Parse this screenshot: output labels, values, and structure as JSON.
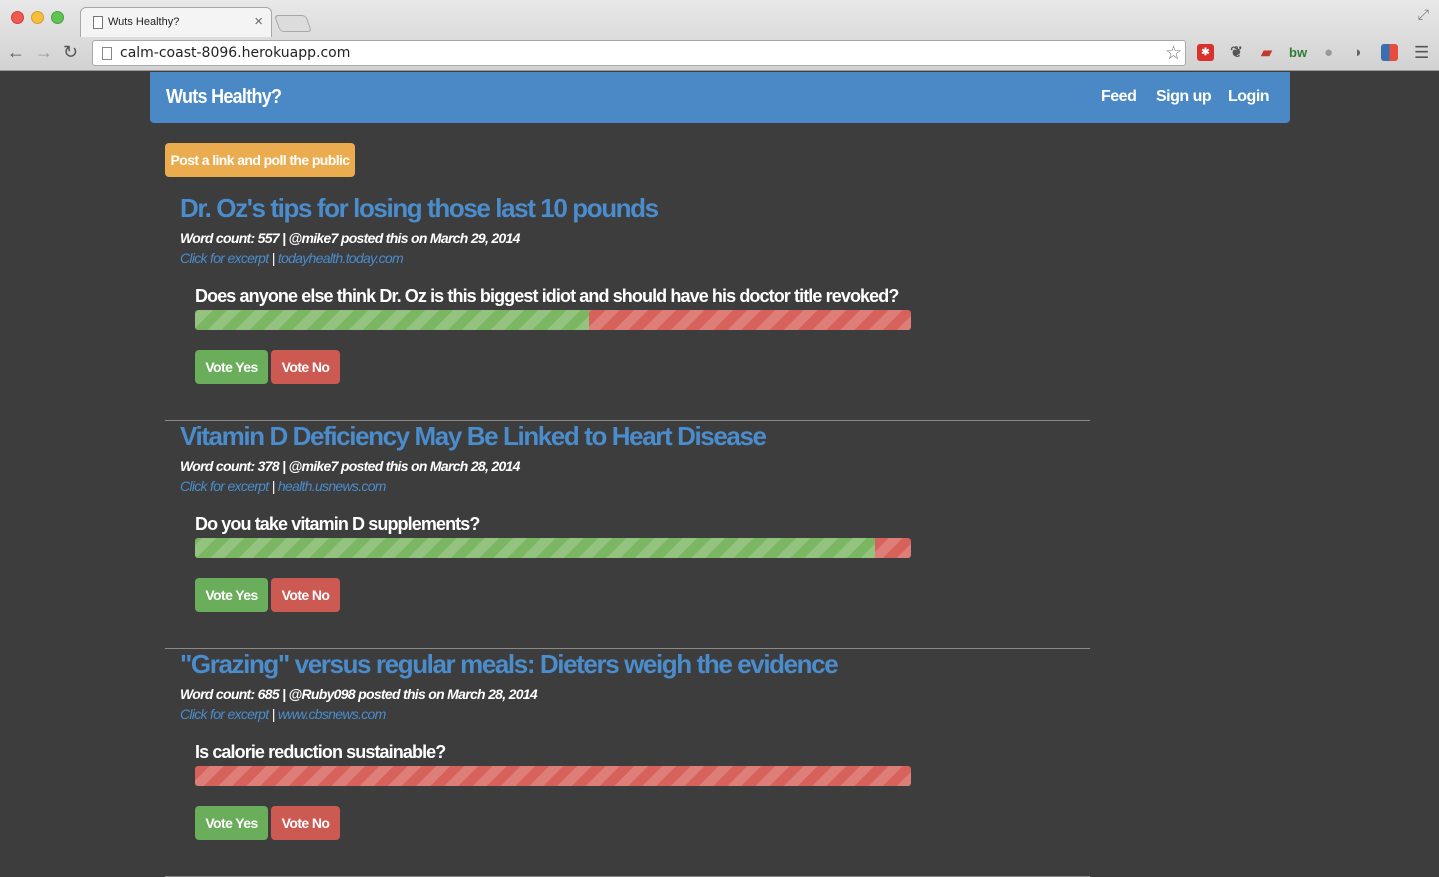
{
  "browser": {
    "tab_title": "Wuts Healthy?",
    "tab_close": "×",
    "url": "calm-coast-8096.herokuapp.com",
    "icons": [
      "back-arrow-icon",
      "forward-arrow-icon",
      "reload-icon",
      "bookmark-star-icon",
      "menu-icon"
    ]
  },
  "navbar": {
    "brand": "Wuts Healthy?",
    "links": [
      "Feed",
      "Sign up",
      "Login"
    ]
  },
  "post_button": "Post a link and poll the public",
  "articles": [
    {
      "title": "Dr. Oz's tips for losing those last 10 pounds",
      "meta": "Word count: 557 | @mike7 posted this on March 29, 2014",
      "excerpt_label": "Click for excerpt",
      "separator": "|",
      "domain": "todayhealth.today.com",
      "question": "Does anyone else think Dr. Oz is this biggest idiot and should have his doctor title revoked?",
      "yes_fraction": 0.55,
      "vote_yes": "Vote Yes",
      "vote_no": "Vote No"
    },
    {
      "title": "Vitamin D Deficiency May Be Linked to Heart Disease",
      "meta": "Word count: 378 | @mike7 posted this on March 28, 2014",
      "excerpt_label": "Click for excerpt",
      "separator": "|",
      "domain": "health.usnews.com",
      "question": "Do you take vitamin D supplements?",
      "yes_fraction": 0.95,
      "vote_yes": "Vote Yes",
      "vote_no": "Vote No"
    },
    {
      "title": "\"Grazing\" versus regular meals: Dieters weigh the evidence",
      "meta": "Word count: 685 | @Ruby098 posted this on March 28, 2014",
      "excerpt_label": "Click for excerpt",
      "separator": "|",
      "domain": "www.cbsnews.com",
      "question": "Is calorie reduction sustainable?",
      "yes_fraction": 0.0,
      "vote_yes": "Vote Yes",
      "vote_no": "Vote No"
    }
  ],
  "colors": {
    "background": "#3d3d3d",
    "navbar": "#4a88c6",
    "link": "#4a8ccc",
    "post_button": "#ebab4f",
    "yes": "#6aad5a",
    "no": "#cd5a52"
  }
}
